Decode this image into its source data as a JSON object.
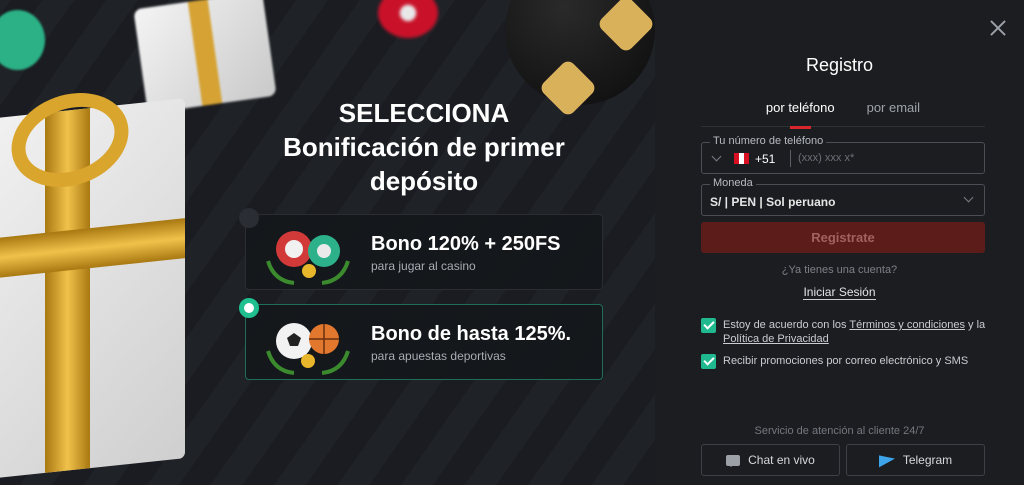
{
  "promo": {
    "title_line1": "SELECCIONA",
    "title_line2": "Bonificación de primer",
    "title_line3": "depósito",
    "bonuses": [
      {
        "headline": "Bono 120% + 250FS",
        "sub": "para jugar al casino",
        "selected": false
      },
      {
        "headline": "Bono de hasta 125%.",
        "sub": "para apuestas deportivas",
        "selected": true
      }
    ]
  },
  "form": {
    "title": "Registro",
    "tabs": [
      {
        "label": "por teléfono",
        "active": true
      },
      {
        "label": "por email",
        "active": false
      }
    ],
    "phone": {
      "legend": "Tu número de teléfono",
      "country_code": "+51",
      "placeholder": "(xxx) xxx x*",
      "value": ""
    },
    "currency": {
      "legend": "Moneda",
      "value": "S/ | PEN | Sol peruano"
    },
    "register_label": "Registrate",
    "have_account": "¿Ya tienes una cuenta?",
    "login_label": "Iniciar Sesión",
    "consent": {
      "pre": "Estoy de acuerdo con los ",
      "terms": "Términos y condiciones",
      "mid": " y la ",
      "privacy": "Política de Privacidad",
      "checked": true
    },
    "promos_consent": {
      "label": "Recibir promociones por correo electrónico y SMS",
      "checked": true
    },
    "support": {
      "label": "Servicio de atención al cliente 24/7",
      "chat_label": "Chat en vivo",
      "telegram_label": "Telegram"
    }
  },
  "colors": {
    "accent_red": "#d8262d",
    "register_disabled": "#5b1c1a",
    "check_green": "#20b98f",
    "telegram_blue": "#3ea4ea"
  },
  "icons": [
    "close-icon",
    "chevron-down-icon",
    "peru-flag-icon",
    "chat-icon",
    "telegram-icon",
    "check-icon",
    "radio-icon"
  ]
}
